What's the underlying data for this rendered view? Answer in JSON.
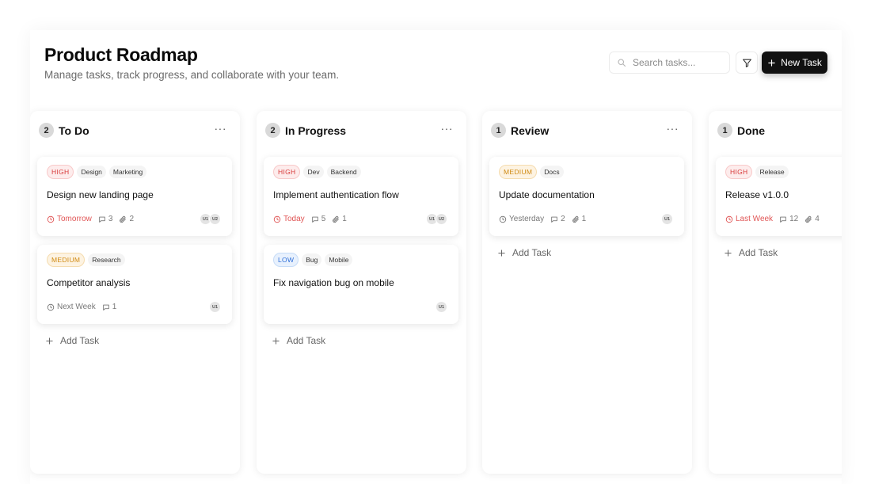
{
  "header": {
    "title": "Product Roadmap",
    "subtitle": "Manage tasks, track progress, and collaborate with your team."
  },
  "toolbar": {
    "search_placeholder": "Search tasks...",
    "new_task_label": "New Task",
    "search_icon": "search-icon",
    "filter_icon": "filter-icon",
    "plus_icon": "plus-icon"
  },
  "colors": {
    "accent": "#111111",
    "high": "#d83b3b",
    "medium": "#d08a12",
    "low": "#2f6fd8",
    "overdue": "#e05555"
  },
  "board": {
    "add_task_label": "Add Task",
    "menu_label": "···",
    "columns": [
      {
        "title": "To Do",
        "count": "2",
        "cards": [
          {
            "priority": "HIGH",
            "priority_level": "high",
            "tags": [
              "Design",
              "Marketing"
            ],
            "title": "Design new landing page",
            "due": "Tomorrow",
            "due_urgent": true,
            "comments": "3",
            "attachments": "2",
            "assignees": [
              "U1",
              "U2"
            ]
          },
          {
            "priority": "MEDIUM",
            "priority_level": "medium",
            "tags": [
              "Research"
            ],
            "title": "Competitor analysis",
            "due": "Next Week",
            "due_urgent": false,
            "comments": "1",
            "attachments": null,
            "assignees": [
              "U1"
            ]
          }
        ]
      },
      {
        "title": "In Progress",
        "count": "2",
        "cards": [
          {
            "priority": "HIGH",
            "priority_level": "high",
            "tags": [
              "Dev",
              "Backend"
            ],
            "title": "Implement authentication flow",
            "due": "Today",
            "due_urgent": true,
            "comments": "5",
            "attachments": "1",
            "assignees": [
              "U1",
              "U2"
            ]
          },
          {
            "priority": "LOW",
            "priority_level": "low",
            "tags": [
              "Bug",
              "Mobile"
            ],
            "title": "Fix navigation bug on mobile",
            "due": null,
            "due_urgent": false,
            "comments": null,
            "attachments": null,
            "assignees": [
              "U1"
            ]
          }
        ]
      },
      {
        "title": "Review",
        "count": "1",
        "cards": [
          {
            "priority": "MEDIUM",
            "priority_level": "medium",
            "tags": [
              "Docs"
            ],
            "title": "Update documentation",
            "due": "Yesterday",
            "due_urgent": false,
            "comments": "2",
            "attachments": "1",
            "assignees": [
              "U1"
            ]
          }
        ]
      },
      {
        "title": "Done",
        "count": "1",
        "cards": [
          {
            "priority": "HIGH",
            "priority_level": "high",
            "tags": [
              "Release"
            ],
            "title": "Release v1.0.0",
            "due": "Last Week",
            "due_urgent": true,
            "comments": "12",
            "attachments": "4",
            "assignees": []
          }
        ]
      }
    ]
  }
}
